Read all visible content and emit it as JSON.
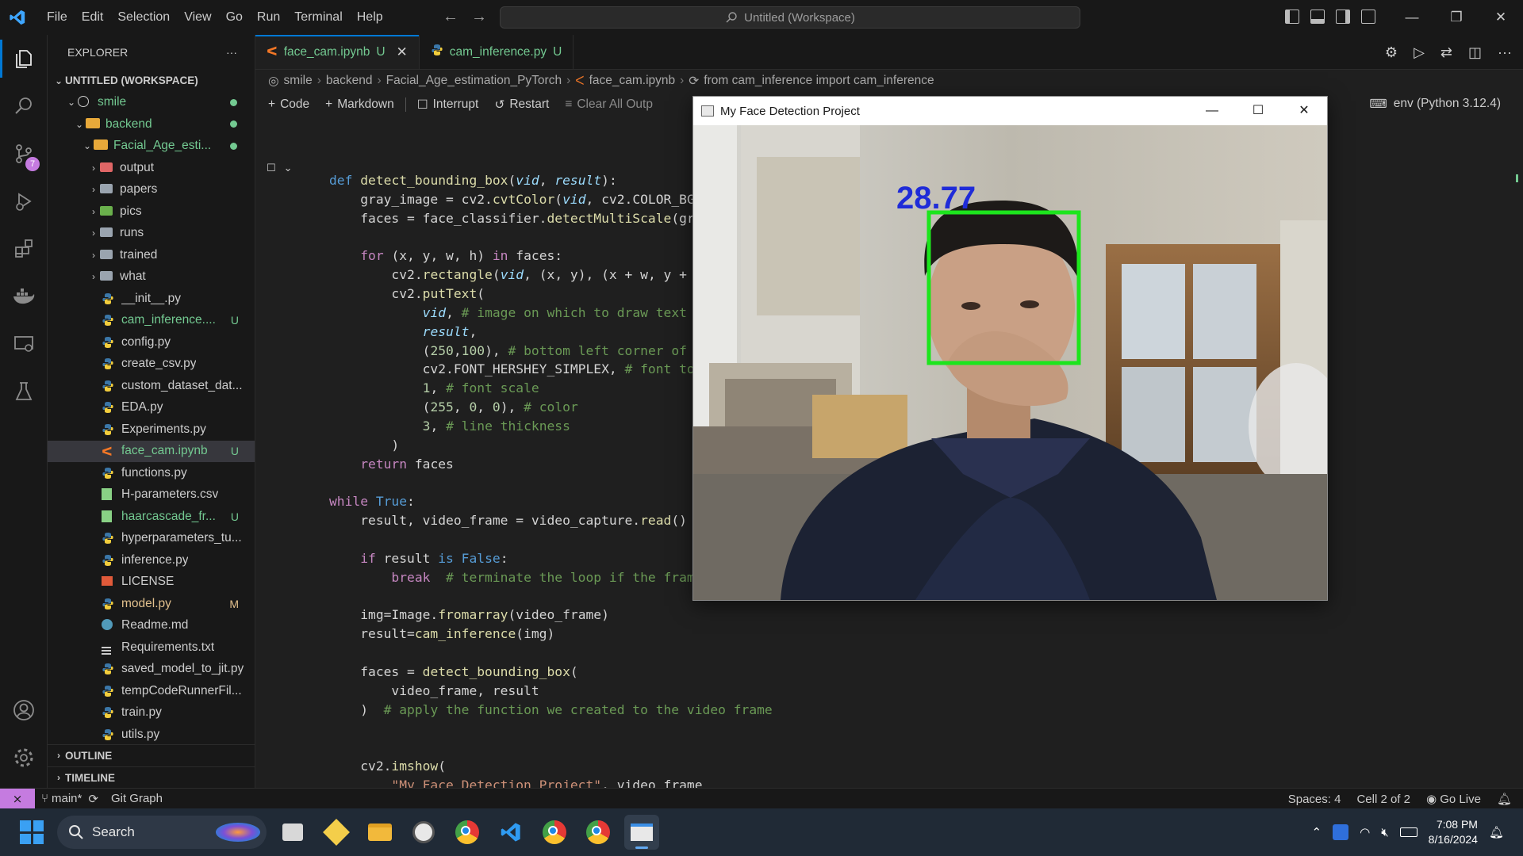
{
  "titlebar": {
    "menu": [
      "File",
      "Edit",
      "Selection",
      "View",
      "Go",
      "Run",
      "Terminal",
      "Help"
    ],
    "search_text": "Untitled (Workspace)"
  },
  "activity_bar": {
    "source_control_badge": "7"
  },
  "explorer": {
    "header": "EXPLORER",
    "more": "···",
    "workspace": "UNTITLED (WORKSPACE)",
    "items": [
      {
        "label": "smile",
        "kind": "root"
      },
      {
        "label": "backend",
        "kind": "folder-open"
      },
      {
        "label": "Facial_Age_esti...",
        "kind": "folder-open"
      },
      {
        "label": "output",
        "kind": "folder"
      },
      {
        "label": "papers",
        "kind": "folder"
      },
      {
        "label": "pics",
        "kind": "folder"
      },
      {
        "label": "runs",
        "kind": "folder"
      },
      {
        "label": "trained",
        "kind": "folder"
      },
      {
        "label": "what",
        "kind": "folder"
      },
      {
        "label": "__init__.py",
        "kind": "py"
      },
      {
        "label": "cam_inference....",
        "kind": "py",
        "status": "U"
      },
      {
        "label": "config.py",
        "kind": "py"
      },
      {
        "label": "create_csv.py",
        "kind": "py"
      },
      {
        "label": "custom_dataset_dat...",
        "kind": "py"
      },
      {
        "label": "EDA.py",
        "kind": "py"
      },
      {
        "label": "Experiments.py",
        "kind": "py"
      },
      {
        "label": "face_cam.ipynb",
        "kind": "ipynb",
        "status": "U"
      },
      {
        "label": "functions.py",
        "kind": "py"
      },
      {
        "label": "H-parameters.csv",
        "kind": "csv"
      },
      {
        "label": "haarcascade_fr...",
        "kind": "xml",
        "status": "U"
      },
      {
        "label": "hyperparameters_tu...",
        "kind": "py"
      },
      {
        "label": "inference.py",
        "kind": "py"
      },
      {
        "label": "LICENSE",
        "kind": "license"
      },
      {
        "label": "model.py",
        "kind": "py",
        "status": "M"
      },
      {
        "label": "Readme.md",
        "kind": "md"
      },
      {
        "label": "Requirements.txt",
        "kind": "txt"
      },
      {
        "label": "saved_model_to_jit.py",
        "kind": "py"
      },
      {
        "label": "tempCodeRunnerFil...",
        "kind": "py"
      },
      {
        "label": "train.py",
        "kind": "py"
      },
      {
        "label": "utils.py",
        "kind": "py"
      }
    ],
    "outline": "OUTLINE",
    "timeline": "TIMELINE"
  },
  "tabs": [
    {
      "label": "face_cam.ipynb",
      "status": "U"
    },
    {
      "label": "cam_inference.py",
      "status": "U"
    }
  ],
  "breadcrumb": [
    "smile",
    "backend",
    "Facial_Age_estimation_PyTorch",
    "face_cam.ipynb",
    "from cam_inference import cam_inference"
  ],
  "notebook_toolbar": {
    "code": "Code",
    "markdown": "Markdown",
    "interrupt": "Interrupt",
    "restart": "Restart",
    "clear": "Clear All Outp"
  },
  "kernel": "env (Python 3.12.4)",
  "cv_window": {
    "title": "My Face Detection Project",
    "age_label": "28.77"
  },
  "statusbar": {
    "branch": "main*",
    "git_graph": "Git Graph",
    "spaces": "Spaces: 4",
    "cell": "Cell 2 of 2",
    "go_live": "Go Live"
  },
  "taskbar": {
    "search": "Search",
    "time": "7:08 PM",
    "date": "8/16/2024"
  },
  "colors": {
    "accent": "#0078d4",
    "remote": "#c57be0",
    "box": "#1de51d",
    "age_text": "#1f2bd8"
  }
}
